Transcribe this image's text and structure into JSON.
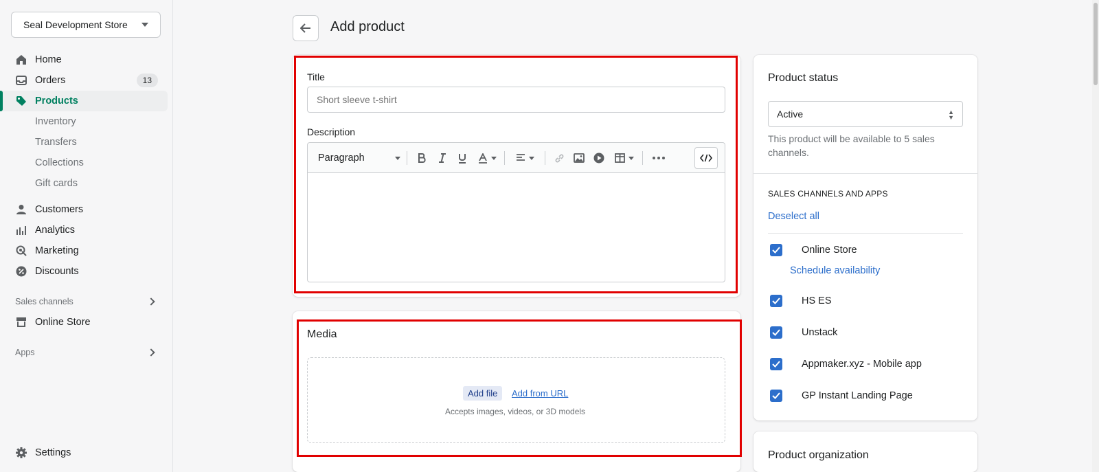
{
  "sidebar": {
    "store_name": "Seal Development Store",
    "items": [
      {
        "label": "Home",
        "icon": "home-icon"
      },
      {
        "label": "Orders",
        "icon": "orders-icon",
        "badge": "13"
      },
      {
        "label": "Products",
        "icon": "tag-icon",
        "active": true
      }
    ],
    "product_sub": [
      "Inventory",
      "Transfers",
      "Collections",
      "Gift cards"
    ],
    "items2": [
      {
        "label": "Customers",
        "icon": "person-icon"
      },
      {
        "label": "Analytics",
        "icon": "bar-chart-icon"
      },
      {
        "label": "Marketing",
        "icon": "target-icon"
      },
      {
        "label": "Discounts",
        "icon": "discount-icon"
      }
    ],
    "sales_channels_label": "Sales channels",
    "online_store_label": "Online Store",
    "apps_label": "Apps",
    "settings_label": "Settings"
  },
  "header": {
    "title": "Add product"
  },
  "title_card": {
    "title_label": "Title",
    "title_placeholder": "Short sleeve t-shirt",
    "description_label": "Description",
    "paragraph_label": "Paragraph"
  },
  "media_card": {
    "title": "Media",
    "add_file": "Add file",
    "add_url": "Add from URL",
    "accepts": "Accepts images, videos, or 3D models"
  },
  "status_card": {
    "title": "Product status",
    "status_value": "Active",
    "help": "This product will be available to 5 sales channels.",
    "channels_heading": "SALES CHANNELS AND APPS",
    "deselect_all": "Deselect all",
    "schedule": "Schedule availability",
    "channels": [
      "Online Store",
      "HS ES",
      "Unstack",
      "Appmaker.xyz - Mobile app",
      "GP Instant Landing Page"
    ]
  },
  "org_card": {
    "title": "Product organization"
  },
  "colors": {
    "accent": "#008060",
    "link": "#2c6ecb",
    "highlight": "#e10000"
  }
}
